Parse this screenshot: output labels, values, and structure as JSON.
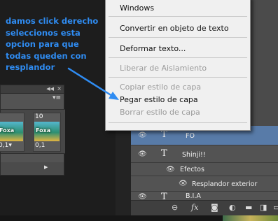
{
  "annotation": {
    "lines": [
      "damos click derecho",
      "seleccionos esta",
      "opcion para que",
      "todas queden con",
      "resplandor"
    ]
  },
  "context_menu": {
    "items": [
      {
        "label": "Windows",
        "enabled": true
      },
      {
        "label": "Convertir en objeto de texto",
        "enabled": true
      },
      {
        "label": "Deformar texto...",
        "enabled": true
      },
      {
        "label": "Liberar de Aislamiento",
        "enabled": false
      },
      {
        "label": "Copiar estilo de capa",
        "enabled": false
      },
      {
        "label": "Pegar estilo de capa",
        "enabled": true
      },
      {
        "label": "Borrar estilo de capa",
        "enabled": false
      }
    ]
  },
  "animation_panel": {
    "frames": [
      {
        "number": "",
        "thumb_text": "Foxa",
        "delay": "0,1"
      },
      {
        "number": "10",
        "thumb_text": "Foxa",
        "delay": "0,1"
      }
    ]
  },
  "layers": {
    "rows": [
      {
        "type": "text",
        "name": "FO",
        "selected": true
      },
      {
        "type": "text",
        "name": "Shinji!!",
        "selected": false
      },
      {
        "type": "effects",
        "name": "Efectos"
      },
      {
        "type": "effect",
        "name": "Resplandor exterior"
      },
      {
        "type": "text",
        "name": "B.I.A",
        "selected": false
      }
    ]
  },
  "colors": {
    "annotation_blue": "#2f8cf2",
    "selected_layer": "#587ba8",
    "menu_bg": "#f0f0f0",
    "disabled_text": "#9a9a9a"
  },
  "icons": {
    "eye": "eye-icon",
    "text_layer": "T",
    "link": "link-icon",
    "fx": "fx-icon",
    "mask": "mask-icon",
    "adjustment": "adjustment-icon",
    "group": "folder-icon",
    "new_layer": "new-layer-icon",
    "delete": "trash-icon"
  }
}
